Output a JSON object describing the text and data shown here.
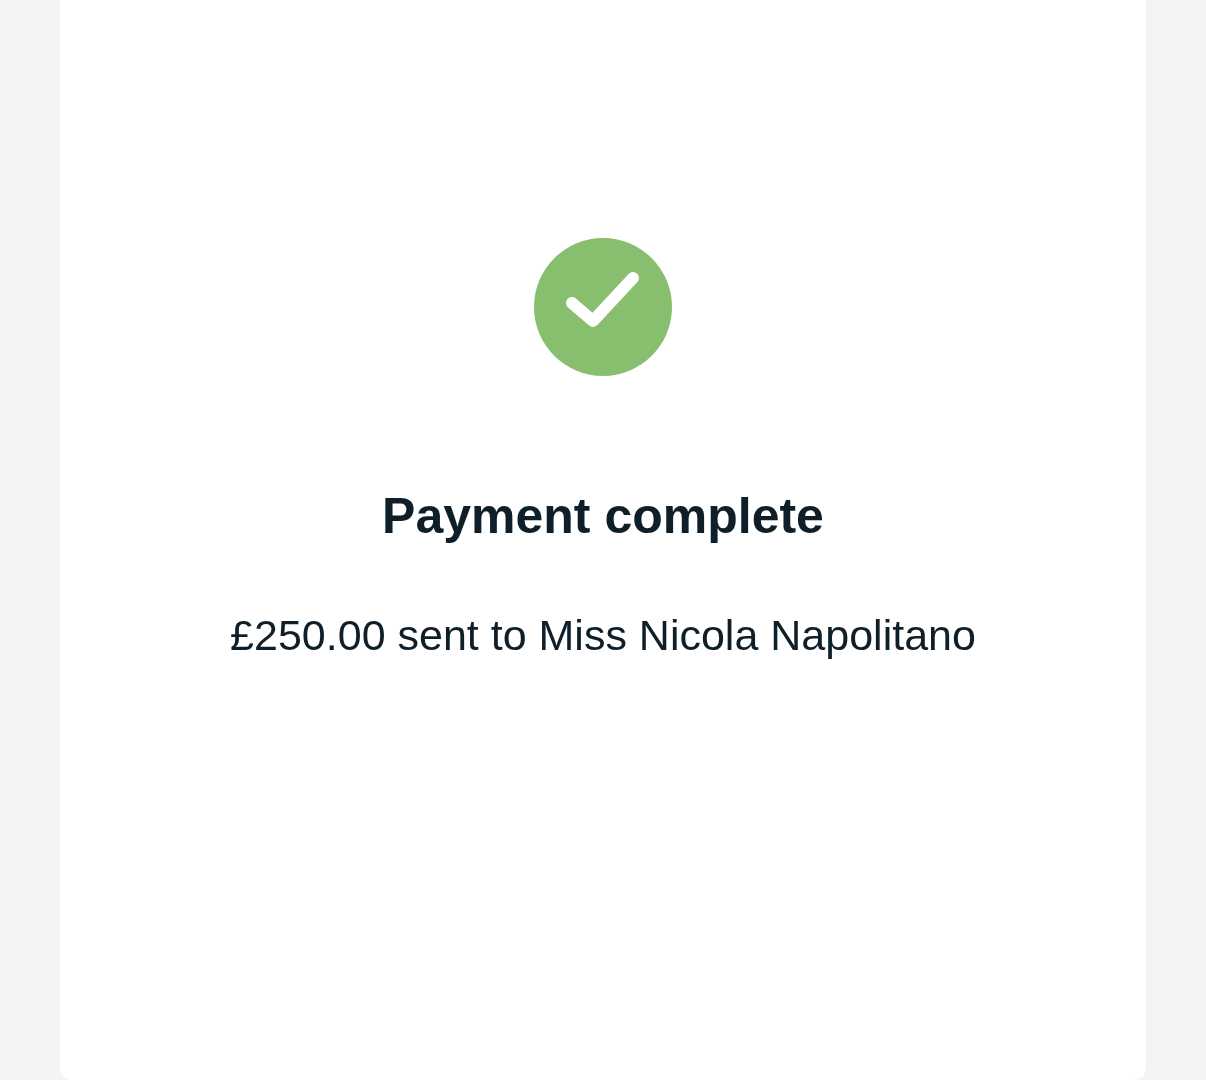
{
  "status": {
    "kind": "success"
  },
  "title": "Payment complete",
  "message": "£250.00 sent to Miss Nicola Napolitano"
}
